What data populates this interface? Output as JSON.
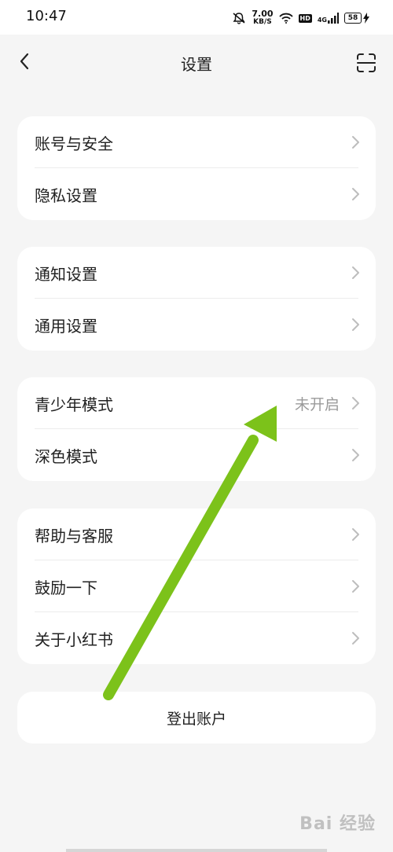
{
  "status_bar": {
    "time": "10:47",
    "net_speed_value": "7.00",
    "net_speed_unit": "KB/S",
    "hd_badge": "HD",
    "network": "4G",
    "battery": "58"
  },
  "header": {
    "title": "设置",
    "back_icon": "chevron-left-icon",
    "scan_icon": "scan-icon"
  },
  "groups": [
    {
      "items": [
        {
          "label": "账号与安全"
        },
        {
          "label": "隐私设置"
        }
      ]
    },
    {
      "items": [
        {
          "label": "通知设置"
        },
        {
          "label": "通用设置"
        }
      ]
    },
    {
      "items": [
        {
          "label": "青少年模式",
          "value": "未开启"
        },
        {
          "label": "深色模式"
        }
      ]
    },
    {
      "items": [
        {
          "label": "帮助与客服"
        },
        {
          "label": "鼓励一下"
        },
        {
          "label": "关于小红书"
        }
      ]
    }
  ],
  "logout": {
    "label": "登出账户"
  },
  "annotation": {
    "arrow_color": "#7cc21a"
  },
  "watermark": {
    "text": "Bai 经验"
  },
  "colors": {
    "background": "#f5f5f5",
    "card": "#ffffff",
    "secondary_text": "#9a9a9a"
  }
}
